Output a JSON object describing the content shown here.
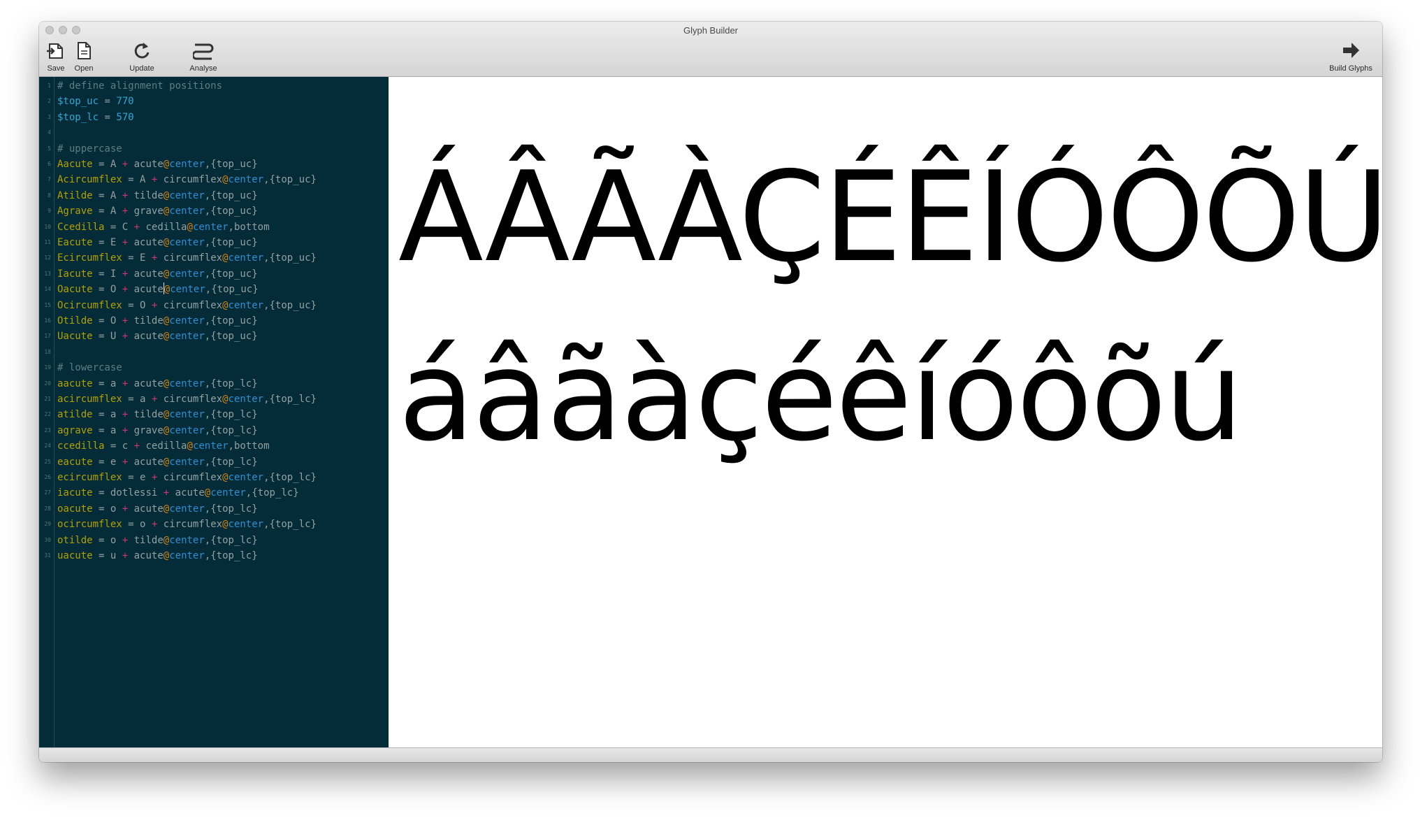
{
  "window": {
    "title": "Glyph Builder"
  },
  "toolbar": {
    "save_label": "Save",
    "open_label": "Open",
    "update_label": "Update",
    "analyse_label": "Analyse",
    "build_label": "Build Glyphs"
  },
  "editor": {
    "line_numbers": [
      "1",
      "2",
      "3",
      "4",
      "5",
      "6",
      "7",
      "8",
      "9",
      "10",
      "11",
      "12",
      "13",
      "14",
      "15",
      "16",
      "17",
      "18",
      "19",
      "20",
      "21",
      "22",
      "23",
      "24",
      "25",
      "26",
      "27",
      "28",
      "29",
      "30",
      "31"
    ],
    "lines": [
      "# define alignment positions",
      "$top_uc = 770",
      "$top_lc = 570",
      "",
      "# uppercase",
      "Aacute = A + acute@center,{top_uc}",
      "Acircumflex = A + circumflex@center,{top_uc}",
      "Atilde = A + tilde@center,{top_uc}",
      "Agrave = A + grave@center,{top_uc}",
      "Ccedilla = C + cedilla@center,bottom",
      "Eacute = E + acute@center,{top_uc}",
      "Ecircumflex = E + circumflex@center,{top_uc}",
      "Iacute = I + acute@center,{top_uc}",
      "Oacute = O + acute@center,{top_uc}",
      "Ocircumflex = O + circumflex@center,{top_uc}",
      "Otilde = O + tilde@center,{top_uc}",
      "Uacute = U + acute@center,{top_uc}",
      "",
      "# lowercase",
      "aacute = a + acute@center,{top_lc}",
      "acircumflex = a + circumflex@center,{top_lc}",
      "atilde = a + tilde@center,{top_lc}",
      "agrave = a + grave@center,{top_lc}",
      "ccedilla = c + cedilla@center,bottom",
      "eacute = e + acute@center,{top_lc}",
      "ecircumflex = e + circumflex@center,{top_lc}",
      "iacute = dotlessi + acute@center,{top_lc}",
      "oacute = o + acute@center,{top_lc}",
      "ocircumflex = o + circumflex@center,{top_lc}",
      "otilde = o + tilde@center,{top_lc}",
      "uacute = u + acute@center,{top_lc}"
    ]
  },
  "preview": {
    "uppercase": "ÁÂÃÀÇÉÊÍÓÔÕÚ",
    "lowercase": "áâãàçéêíóôõú"
  },
  "icons": {
    "save": "save-icon",
    "open": "document-icon",
    "update": "refresh-icon",
    "analyse": "analyse-icon",
    "build": "arrow-right-icon"
  },
  "colors": {
    "editor_bg": "#032c38",
    "comment": "#5e7d84",
    "variable": "#2fa8d6",
    "glyph_name": "#b5a100",
    "operator": "#d23672",
    "at_sign": "#d8830f",
    "keyword": "#2e8fd2"
  }
}
